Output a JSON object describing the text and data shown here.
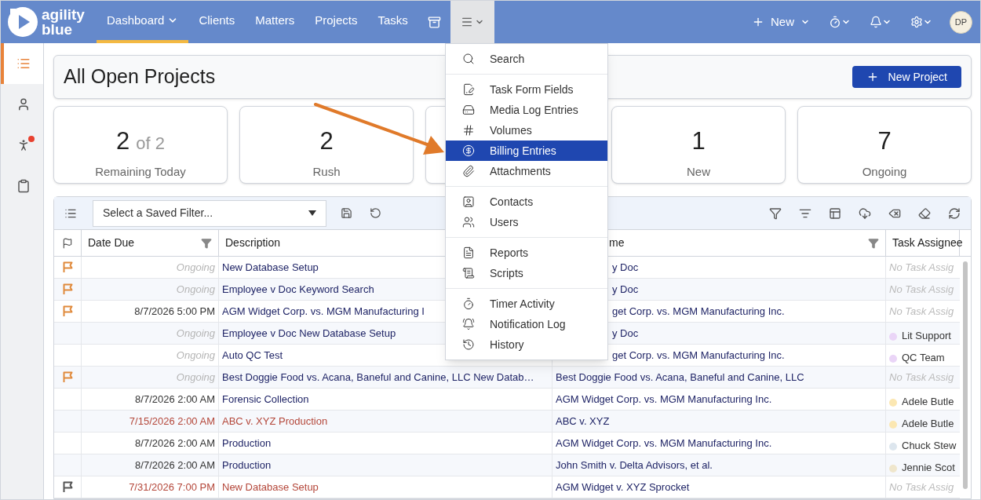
{
  "header": {
    "logo_top": "agility",
    "logo_bottom": "blue",
    "nav": [
      {
        "label": "Dashboard",
        "dropdown": true,
        "selected": true
      },
      {
        "label": "Clients",
        "dropdown": false,
        "selected": false
      },
      {
        "label": "Matters",
        "dropdown": false,
        "selected": false
      },
      {
        "label": "Projects",
        "dropdown": false,
        "selected": false
      },
      {
        "label": "Tasks",
        "dropdown": false,
        "selected": false
      }
    ],
    "more_menu": {
      "expanded": true
    },
    "new_button": "New",
    "avatar": "DP"
  },
  "sidebar": [
    {
      "kind": "list",
      "selected": true,
      "badge": false
    },
    {
      "kind": "person",
      "selected": false,
      "badge": false
    },
    {
      "kind": "people",
      "selected": false,
      "badge": true
    },
    {
      "kind": "clipboard",
      "selected": false,
      "badge": false
    }
  ],
  "page_title": "All Open Projects",
  "new_project_button": "New Project",
  "stats": [
    {
      "kind": "number",
      "value": "2",
      "suffix": "of 2",
      "label": "Remaining Today"
    },
    {
      "kind": "number",
      "value": "2",
      "label": "Rush"
    },
    {
      "kind": "covered"
    },
    {
      "kind": "number",
      "value": "1",
      "label": "New"
    },
    {
      "kind": "number",
      "value": "7",
      "label": "Ongoing"
    }
  ],
  "filter": {
    "placeholder": "Select a Saved Filter..."
  },
  "table": {
    "columns": [
      {
        "label": "Date Due",
        "filter": true
      },
      {
        "label": "Description",
        "filter": false
      },
      {
        "label": "me",
        "filter": true
      },
      {
        "label": "Task Assignee",
        "filter": false
      }
    ],
    "rows": [
      {
        "kind": "ongoing",
        "flag": {
          "color": "#e08a3c"
        },
        "date": "Ongoing",
        "description": "New Database Setup",
        "matter": "y Doc",
        "assignee": {
          "name": "No Task Assig",
          "assigned": false
        }
      },
      {
        "kind": "ongoing",
        "flag": {
          "color": "#e08a3c"
        },
        "date": "Ongoing",
        "description": "Employee v Doc Keyword Search",
        "matter": "y Doc",
        "assignee": {
          "name": "No Task Assig",
          "assigned": false
        }
      },
      {
        "kind": "normal",
        "flag": {
          "color": "#e08a3c"
        },
        "date": "8/7/2026 5:00 PM",
        "description": "AGM Widget Corp. vs. MGM Manufacturing I",
        "matter": "get Corp. vs. MGM Manufacturing Inc.",
        "assignee": {
          "name": "No Task Assig",
          "assigned": false
        }
      },
      {
        "kind": "ongoing",
        "date": "Ongoing",
        "description": "Employee v Doc New Database Setup",
        "matter": "y Doc",
        "assignee": {
          "name": "Lit Support",
          "assigned": true,
          "color": "#ead5f7"
        }
      },
      {
        "kind": "ongoing",
        "date": "Ongoing",
        "description": "Auto QC Test",
        "matter": "get Corp. vs. MGM Manufacturing Inc.",
        "assignee": {
          "name": "QC Team",
          "assigned": true,
          "color": "#ead5f7"
        }
      },
      {
        "kind": "ongoing",
        "flag": {
          "color": "#e08a3c"
        },
        "date": "Ongoing",
        "description": "Best Doggie Food vs. Acana, Baneful and Canine, LLC New Datab…",
        "matter": "Best Doggie Food vs. Acana, Baneful and Canine, LLC",
        "assignee": {
          "name": "No Task Assig",
          "assigned": false
        }
      },
      {
        "kind": "normal",
        "date": "8/7/2026 2:00 AM",
        "description": "Forensic Collection",
        "matter": "AGM Widget Corp. vs. MGM Manufacturing Inc.",
        "assignee": {
          "name": "Adele Butle",
          "assigned": true,
          "color": "#fbe7b2"
        }
      },
      {
        "kind": "overdue",
        "date": "7/15/2026 2:00 AM",
        "description": "ABC v. XYZ Production",
        "matter": "ABC v. XYZ",
        "assignee": {
          "name": "Adele Butle",
          "assigned": true,
          "color": "#fbe7b2"
        }
      },
      {
        "kind": "normal",
        "date": "8/7/2026 2:00 AM",
        "description": "Production",
        "matter": "AGM Widget Corp. vs. MGM Manufacturing Inc.",
        "assignee": {
          "name": "Chuck Stew",
          "assigned": true,
          "color": "#dde6ee"
        }
      },
      {
        "kind": "normal",
        "date": "8/7/2026 2:00 AM",
        "description": "Production",
        "matter": "John Smith v. Delta Advisors, et al.",
        "assignee": {
          "name": "Jennie Scot",
          "assigned": true,
          "color": "#efe6cc"
        }
      },
      {
        "kind": "overdue",
        "flag": {
          "color": "#555555"
        },
        "date": "7/31/2026 7:00 PM",
        "description": "New Database Setup",
        "matter": "AGM Widget v. XYZ Sprocket",
        "assignee": {
          "name": "No Task Assig",
          "assigned": false
        }
      }
    ]
  },
  "menu": {
    "groups": [
      [
        {
          "kind": "search",
          "label": "Search",
          "selected": false
        }
      ],
      [
        {
          "kind": "form",
          "label": "Task Form Fields",
          "selected": false
        },
        {
          "kind": "drive",
          "label": "Media Log Entries",
          "selected": false
        },
        {
          "kind": "hash",
          "label": "Volumes",
          "selected": false
        },
        {
          "kind": "dollar",
          "label": "Billing Entries",
          "selected": true
        },
        {
          "kind": "paperclip",
          "label": "Attachments",
          "selected": false
        }
      ],
      [
        {
          "kind": "contact",
          "label": "Contacts",
          "selected": false
        },
        {
          "kind": "users",
          "label": "Users",
          "selected": false
        }
      ],
      [
        {
          "kind": "file",
          "label": "Reports",
          "selected": false
        },
        {
          "kind": "scroll",
          "label": "Scripts",
          "selected": false
        }
      ],
      [
        {
          "kind": "timer",
          "label": "Timer Activity",
          "selected": false
        },
        {
          "kind": "bell",
          "label": "Notification Log",
          "selected": false
        },
        {
          "kind": "history",
          "label": "History",
          "selected": false
        }
      ]
    ]
  }
}
